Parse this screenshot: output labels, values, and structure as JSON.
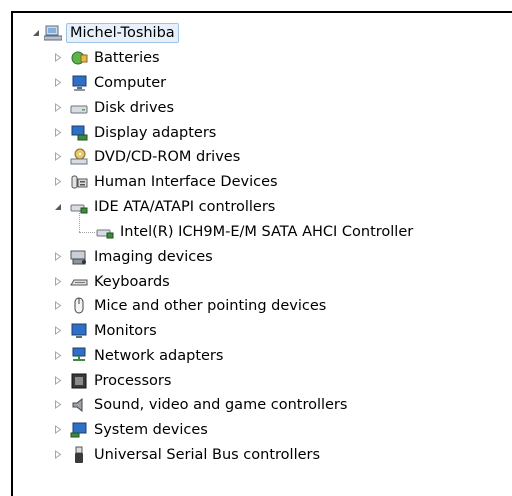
{
  "root": {
    "label": "Michel-Toshiba",
    "icon": "computer-root-icon"
  },
  "categories": [
    {
      "label": "Batteries",
      "icon": "battery-icon"
    },
    {
      "label": "Computer",
      "icon": "computer-icon"
    },
    {
      "label": "Disk drives",
      "icon": "disk-drive-icon"
    },
    {
      "label": "Display adapters",
      "icon": "display-adapter-icon"
    },
    {
      "label": "DVD/CD-ROM drives",
      "icon": "dvd-drive-icon"
    },
    {
      "label": "Human Interface Devices",
      "icon": "hid-icon"
    },
    {
      "label": "IDE ATA/ATAPI controllers",
      "icon": "ide-controller-icon",
      "expanded": true,
      "children": [
        {
          "label": "Intel(R) ICH9M-E/M SATA AHCI Controller",
          "icon": "sata-controller-icon"
        }
      ]
    },
    {
      "label": "Imaging devices",
      "icon": "imaging-device-icon"
    },
    {
      "label": "Keyboards",
      "icon": "keyboard-icon"
    },
    {
      "label": "Mice and other pointing devices",
      "icon": "mouse-icon"
    },
    {
      "label": "Monitors",
      "icon": "monitor-icon"
    },
    {
      "label": "Network adapters",
      "icon": "network-adapter-icon"
    },
    {
      "label": "Processors",
      "icon": "processor-icon"
    },
    {
      "label": "Sound, video and game controllers",
      "icon": "sound-icon"
    },
    {
      "label": "System devices",
      "icon": "system-device-icon"
    },
    {
      "label": "Universal Serial Bus controllers",
      "icon": "usb-icon"
    }
  ],
  "colors": {
    "selection_bg": "#e8f1fb",
    "selection_border": "#9ec3e8"
  }
}
